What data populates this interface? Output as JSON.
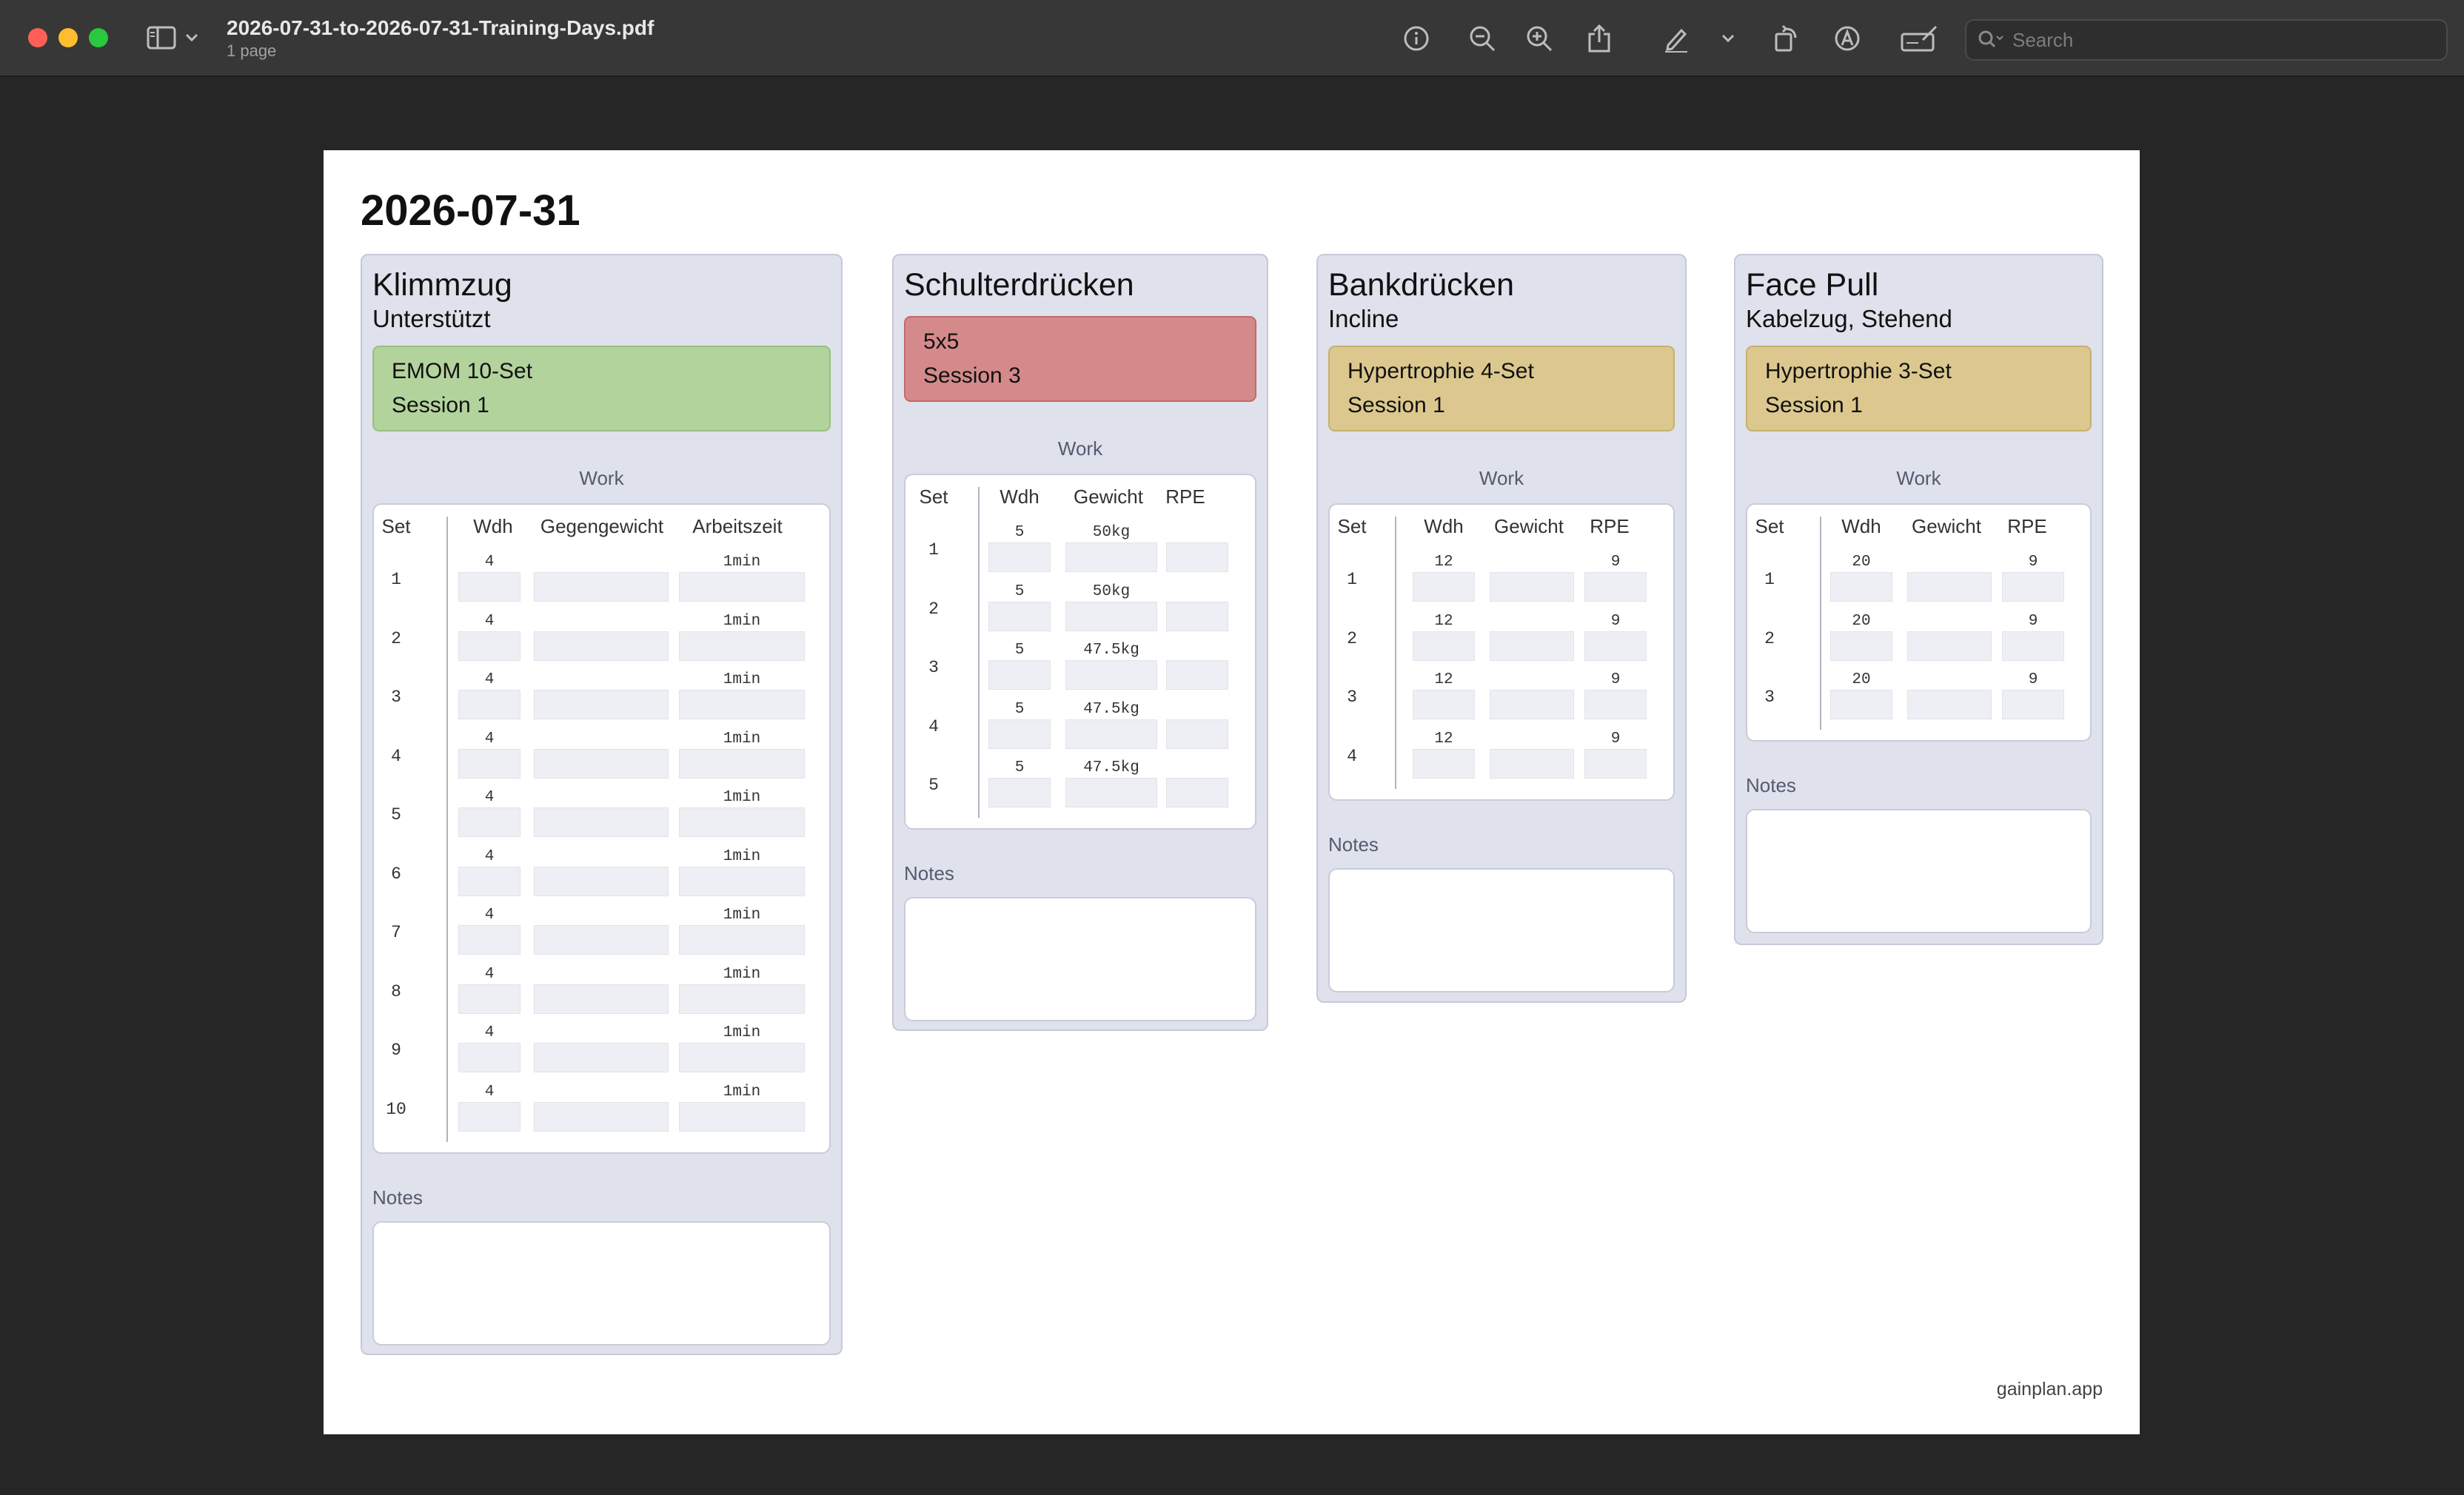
{
  "window": {
    "title": "2026-07-31-to-2026-07-31-Training-Days.pdf",
    "subtitle": "1 page",
    "search_placeholder": "Search"
  },
  "toolbar": {
    "icons": [
      "sidebar-icon",
      "chevron-down-icon",
      "info-icon",
      "zoom-out-icon",
      "zoom-in-icon",
      "share-icon",
      "pen-icon",
      "chevron-down-icon",
      "rotate-icon",
      "markup-icon",
      "signature-icon"
    ]
  },
  "page": {
    "date": "2026-07-31",
    "footer": "gainplan.app"
  },
  "exercises": [
    {
      "title": "Klimmzug",
      "subtitle": "Unterstützt",
      "program": "EMOM 10-Set",
      "session": "Session 1",
      "program_color": "#b3d39c",
      "section_label": "Work",
      "columns": [
        "Set",
        "Wdh",
        "Gegengewicht",
        "Arbeitszeit"
      ],
      "rows": [
        {
          "set": "1",
          "values": [
            "4",
            "",
            "1min"
          ]
        },
        {
          "set": "2",
          "values": [
            "4",
            "",
            "1min"
          ]
        },
        {
          "set": "3",
          "values": [
            "4",
            "",
            "1min"
          ]
        },
        {
          "set": "4",
          "values": [
            "4",
            "",
            "1min"
          ]
        },
        {
          "set": "5",
          "values": [
            "4",
            "",
            "1min"
          ]
        },
        {
          "set": "6",
          "values": [
            "4",
            "",
            "1min"
          ]
        },
        {
          "set": "7",
          "values": [
            "4",
            "",
            "1min"
          ]
        },
        {
          "set": "8",
          "values": [
            "4",
            "",
            "1min"
          ]
        },
        {
          "set": "9",
          "values": [
            "4",
            "",
            "1min"
          ]
        },
        {
          "set": "10",
          "values": [
            "4",
            "",
            "1min"
          ]
        }
      ],
      "notes_label": "Notes"
    },
    {
      "title": "Schulterdrücken",
      "subtitle": "",
      "program": "5x5",
      "session": "Session 3",
      "program_color": "#d48a8a",
      "section_label": "Work",
      "columns": [
        "Set",
        "Wdh",
        "Gewicht",
        "RPE"
      ],
      "rows": [
        {
          "set": "1",
          "values": [
            "5",
            "50kg",
            ""
          ]
        },
        {
          "set": "2",
          "values": [
            "5",
            "50kg",
            ""
          ]
        },
        {
          "set": "3",
          "values": [
            "5",
            "47.5kg",
            ""
          ]
        },
        {
          "set": "4",
          "values": [
            "5",
            "47.5kg",
            ""
          ]
        },
        {
          "set": "5",
          "values": [
            "5",
            "47.5kg",
            ""
          ]
        }
      ],
      "notes_label": "Notes"
    },
    {
      "title": "Bankdrücken",
      "subtitle": "Incline",
      "program": "Hypertrophie 4-Set",
      "session": "Session 1",
      "program_color": "#dcc88e",
      "section_label": "Work",
      "columns": [
        "Set",
        "Wdh",
        "Gewicht",
        "RPE"
      ],
      "rows": [
        {
          "set": "1",
          "values": [
            "12",
            "",
            "9"
          ]
        },
        {
          "set": "2",
          "values": [
            "12",
            "",
            "9"
          ]
        },
        {
          "set": "3",
          "values": [
            "12",
            "",
            "9"
          ]
        },
        {
          "set": "4",
          "values": [
            "12",
            "",
            "9"
          ]
        }
      ],
      "notes_label": "Notes"
    },
    {
      "title": "Face Pull",
      "subtitle": "Kabelzug, Stehend",
      "program": "Hypertrophie 3-Set",
      "session": "Session 1",
      "program_color": "#dcc88e",
      "section_label": "Work",
      "columns": [
        "Set",
        "Wdh",
        "Gewicht",
        "RPE"
      ],
      "rows": [
        {
          "set": "1",
          "values": [
            "20",
            "",
            "9"
          ]
        },
        {
          "set": "2",
          "values": [
            "20",
            "",
            "9"
          ]
        },
        {
          "set": "3",
          "values": [
            "20",
            "",
            "9"
          ]
        }
      ],
      "notes_label": "Notes"
    }
  ]
}
